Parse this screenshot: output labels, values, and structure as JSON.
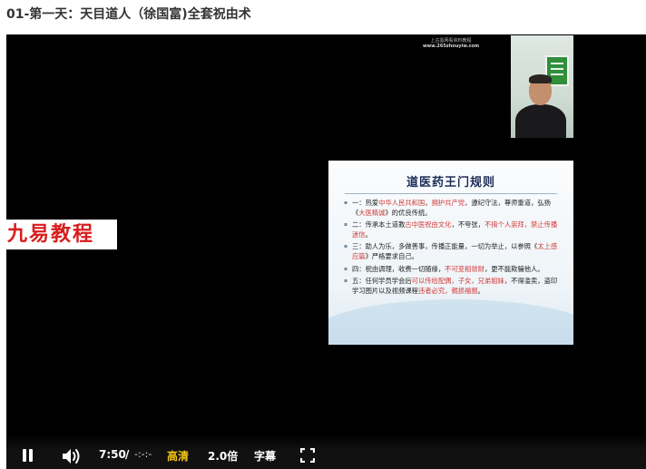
{
  "page": {
    "title": "01-第一天：天目道人（徐国富)全套祝由术"
  },
  "video": {
    "watermark_line1": "上古盈网看资料教程",
    "watermark_line2": "www.265zhouyiw.com",
    "brand_logo": "九易教程",
    "slide": {
      "title": "道医药王门规则",
      "rules": [
        [
          {
            "t": "一：热爱",
            "hl": false
          },
          {
            "t": "中华人民共和国",
            "hl": true
          },
          {
            "t": "，",
            "hl": false
          },
          {
            "t": "拥护共产党",
            "hl": true
          },
          {
            "t": "，遵纪守法，尊师重道，弘扬《",
            "hl": false
          },
          {
            "t": "大医精诚",
            "hl": true
          },
          {
            "t": "》的优良传统。",
            "hl": false
          }
        ],
        [
          {
            "t": "二：传承本土道教",
            "hl": false
          },
          {
            "t": "古中医祝由文化",
            "hl": true
          },
          {
            "t": "，不夸张，",
            "hl": false
          },
          {
            "t": "不搞个人崇拜，禁止传播迷信",
            "hl": true
          },
          {
            "t": "。",
            "hl": false
          }
        ],
        [
          {
            "t": "三：助人为乐，多做善事，传播正能量，一切为举止，以参照《",
            "hl": false
          },
          {
            "t": "太上感应篇",
            "hl": true
          },
          {
            "t": "》严格要求自己。",
            "hl": false
          }
        ],
        [
          {
            "t": "四：祝由调理，收费一切随缘，",
            "hl": false
          },
          {
            "t": "不可变相敛财",
            "hl": true
          },
          {
            "t": "，更不能欺骗他人。",
            "hl": false
          }
        ],
        [
          {
            "t": "五：任何学员学会后",
            "hl": false
          },
          {
            "t": "可以传给配偶，子女，兄弟姐妹",
            "hl": true
          },
          {
            "t": "，不得滥卖，盗印学习图片以及视频课程",
            "hl": false
          },
          {
            "t": "违者必究，親损福报",
            "hl": true
          },
          {
            "t": "。",
            "hl": false
          }
        ]
      ]
    }
  },
  "controls": {
    "current_time": "7:50",
    "time_separator": "/",
    "total_time": "-:-:-",
    "quality_label": "高清",
    "speed_label": "2.0倍",
    "subtitle_label": "字幕",
    "icons": {
      "pause": "pause-icon",
      "volume": "volume-icon",
      "fullscreen": "fullscreen-icon"
    },
    "colors": {
      "accent": "#f5c518",
      "text": "#ffffff"
    }
  }
}
